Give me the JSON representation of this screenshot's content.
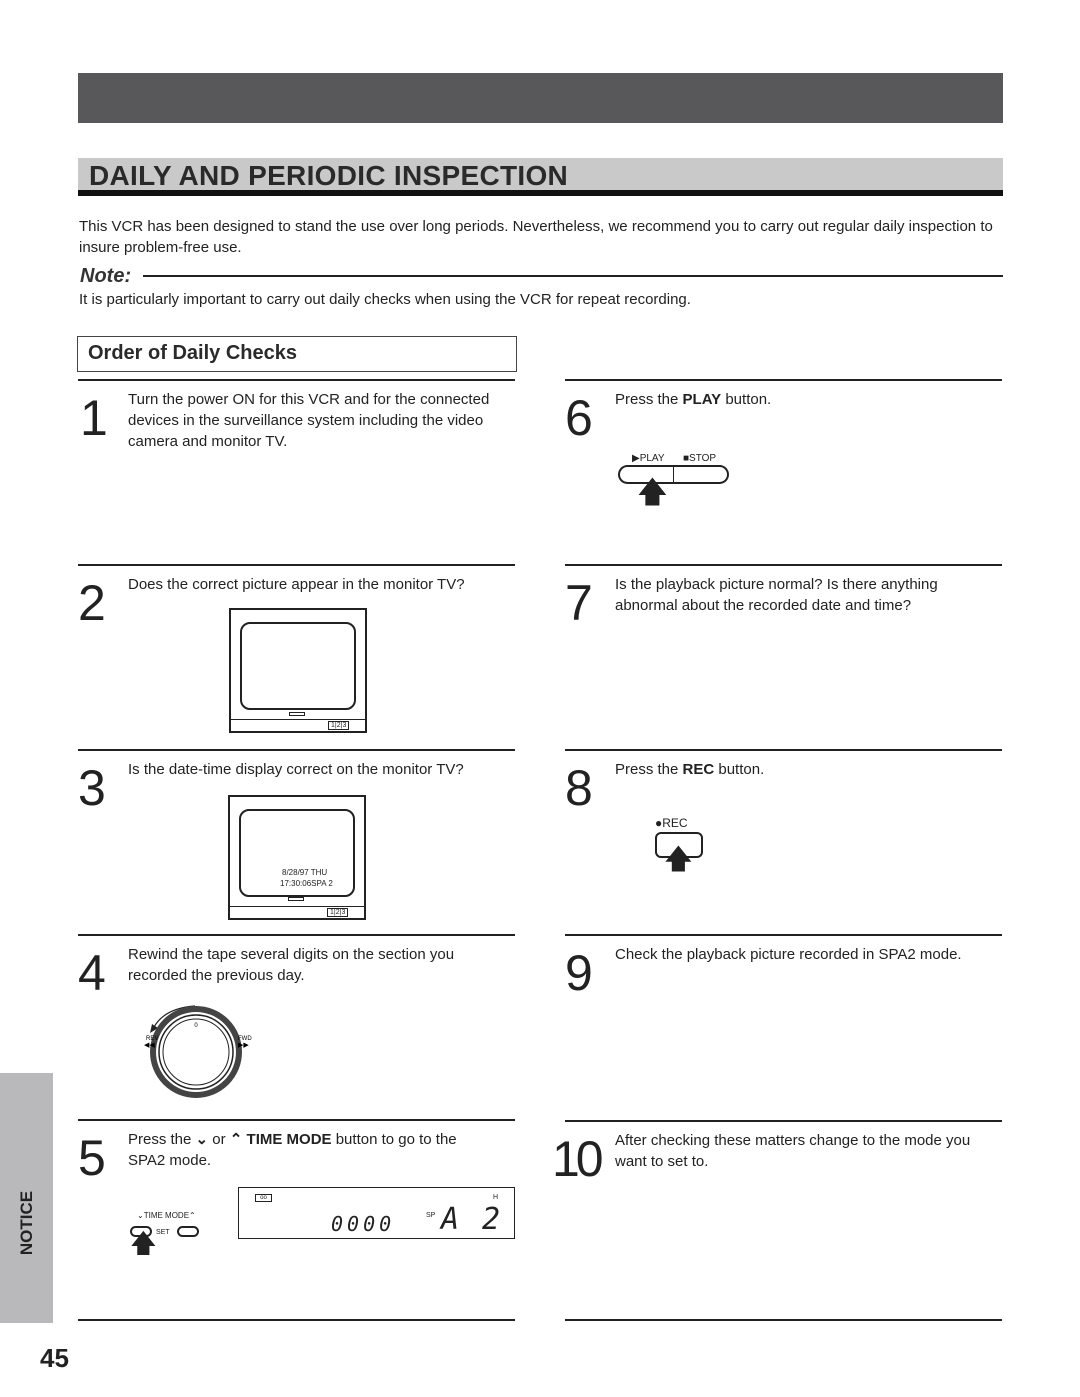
{
  "title": "DAILY AND PERIODIC INSPECTION",
  "intro": "This VCR has been designed to stand the use over long periods. Nevertheless, we recommend you to carry out regular daily inspection to insure problem-free use.",
  "note": {
    "label": "Note:",
    "text": "It is particularly important to carry out daily checks when using the VCR for repeat recording."
  },
  "section_title": "Order of Daily Checks",
  "steps": [
    {
      "num": "1",
      "text": "Turn the power ON for this VCR and for the connected devices in the surveillance system including the video camera and monitor TV."
    },
    {
      "num": "2",
      "text": "Does the correct picture appear in the monitor TV?"
    },
    {
      "num": "3",
      "text": "Is the date-time display correct on the monitor TV?"
    },
    {
      "num": "4",
      "text": "Rewind the tape several digits on the section you recorded the previous day."
    },
    {
      "num": "5",
      "pre": "Press the ",
      "mid": " or ",
      "bold": "TIME MODE",
      "post": " button to go to the SPA2 mode."
    },
    {
      "num": "6",
      "pre": "Press the ",
      "bold": "PLAY",
      "post": " button."
    },
    {
      "num": "7",
      "text": "Is the playback picture normal? Is there anything abnormal about the recorded date and time?"
    },
    {
      "num": "8",
      "pre": "Press the  ",
      "bold": "REC",
      "post": " button."
    },
    {
      "num": "9",
      "text": "Check the playback picture recorded in SPA2 mode."
    },
    {
      "num": "10",
      "text": "After checking these matters change to the mode you want to set to."
    }
  ],
  "illustrations": {
    "tv_buttons": [
      "1",
      "2",
      "3"
    ],
    "osd_date": "8/28/97 THU",
    "osd_time": "17:30:06SPA 2",
    "dial": {
      "rev": "REV",
      "ffwd": "FWD",
      "mark": "0"
    },
    "play_label": "PLAY",
    "stop_label": "STOP",
    "rec_label": "REC",
    "time_mode": "TIME MODE",
    "set": "SET",
    "minus": "−",
    "plus": "+",
    "display": {
      "counter": "0000",
      "sp": "SP",
      "mode": "A",
      "digit": "2",
      "h": "H"
    }
  },
  "side_tab": "NOTICE",
  "page_number": "45",
  "colors": {
    "header": "#58585a",
    "title_bg": "#c9c9c9",
    "side_tab": "#b9b9bb"
  }
}
